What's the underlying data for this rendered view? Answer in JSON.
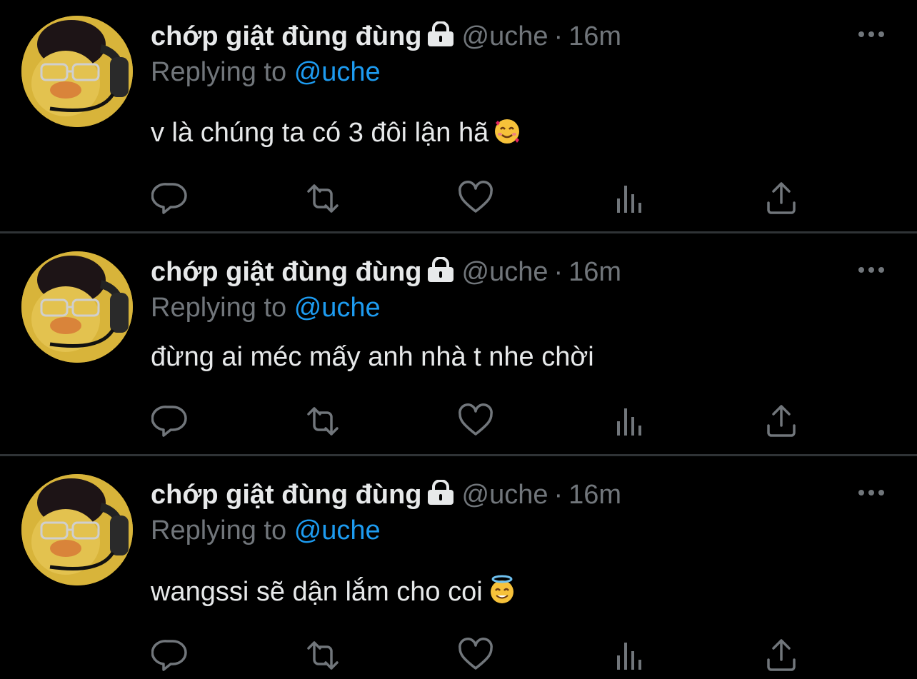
{
  "colors": {
    "background": "#000000",
    "primary_text": "#e7e9ea",
    "secondary_text": "#71767b",
    "accent": "#1d9bf0",
    "divider": "#2f3336"
  },
  "icons": [
    "lock-icon",
    "more-icon",
    "reply-icon",
    "retweet-icon",
    "like-icon",
    "views-icon",
    "share-icon"
  ],
  "tweets": [
    {
      "name": "chớp giật đùng đùng",
      "handle": "@uche",
      "separator": "·",
      "time": "16m",
      "replying_prefix": "Replying to",
      "replying_to": "@uche",
      "text": "v là chúng ta có 3 đôi lận hã",
      "emoji": "🥰"
    },
    {
      "name": "chớp giật đùng đùng",
      "handle": "@uche",
      "separator": "·",
      "time": "16m",
      "replying_prefix": "Replying to",
      "replying_to": "@uche",
      "text": "đừng ai méc mấy anh nhà t nhe chời"
    },
    {
      "name": "chớp giật đùng đùng",
      "handle": "@uche",
      "separator": "·",
      "time": "16m",
      "replying_prefix": "Replying to",
      "replying_to": "@uche",
      "text": "wangssi sẽ dận lắm cho coi",
      "emoji": "😇"
    }
  ]
}
